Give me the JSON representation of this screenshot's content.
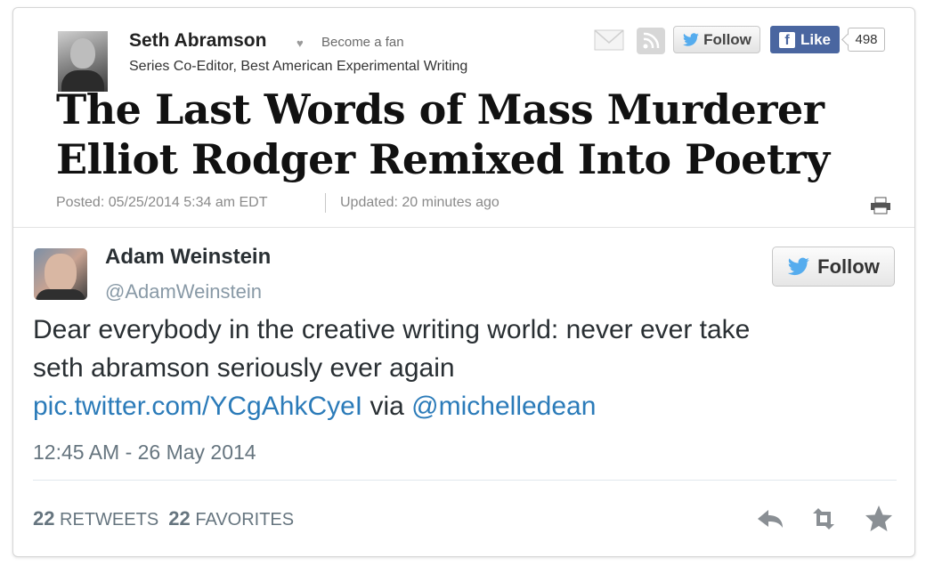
{
  "article": {
    "author_name": "Seth Abramson",
    "become_fan": "Become a fan",
    "author_title": "Series Co-Editor, Best American Experimental Writing",
    "follow_label": "Follow",
    "like_label": "Like",
    "like_count": "498",
    "headline_line1": "The Last Words of Mass Murderer",
    "headline_line2": "Elliot Rodger Remixed Into Poetry",
    "posted": "Posted: 05/25/2014 5:34 am EDT",
    "updated": "Updated: 20 minutes ago"
  },
  "tweet": {
    "name": "Adam Weinstein",
    "handle": "@AdamWeinstein",
    "follow_label": "Follow",
    "text_line1": "Dear everybody in the creative writing world: never ever take",
    "text_line2": "seth abramson seriously ever again",
    "link": "pic.twitter.com/YCgAhkCyeI",
    "via": "via",
    "mention": "@michelledean",
    "timestamp": "12:45 AM - 26 May 2014",
    "retweets_count": "22",
    "retweets_label": "RETWEETS",
    "favorites_count": "22",
    "favorites_label": "FAVORITES"
  },
  "icons": [
    "heart-icon",
    "mail-icon",
    "rss-icon",
    "twitter-bird-icon",
    "facebook-icon",
    "print-icon",
    "reply-icon",
    "retweet-icon",
    "favorite-star-icon"
  ],
  "colors": {
    "twitter_link": "#2b7bb9",
    "facebook_blue": "#4a66a0",
    "twitter_bird": "#55acee",
    "muted_text": "#66757f"
  }
}
